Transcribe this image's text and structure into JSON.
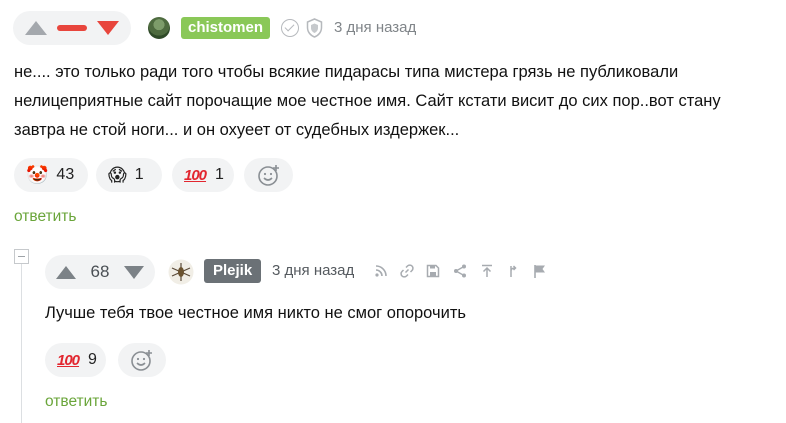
{
  "top_comment": {
    "username": "chistomen",
    "time": "3 дня назад",
    "text": "не.... это только ради того чтобы всякие пидарасы типа мистера грязь не публиковали нелицеприятные сайт порочащие мое честное имя. Сайт кстати висит до сих пор..вот стану завтра не стой ноги... и он охуеет от судебных издержек...",
    "reactions": [
      {
        "icon": "clown-emoji",
        "count": "43"
      },
      {
        "icon": "scared-face-emoji",
        "count": "1"
      },
      {
        "icon": "hundred-points-emoji",
        "label": "100",
        "count": "1"
      }
    ],
    "reply_label": "ответить"
  },
  "nested_comment": {
    "score": "68",
    "username": "Plejik",
    "time": "3 дня назад",
    "text": "Лучше тебя твое честное имя никто не смог опорочить",
    "reactions": [
      {
        "icon": "hundred-points-emoji",
        "label": "100",
        "count": "9"
      }
    ],
    "reply_label": "ответить"
  },
  "colors": {
    "accent_green": "#8ac858",
    "link_green": "#6aa53a",
    "downvote_red": "#e8453c",
    "grey_tag": "#6b7176"
  }
}
